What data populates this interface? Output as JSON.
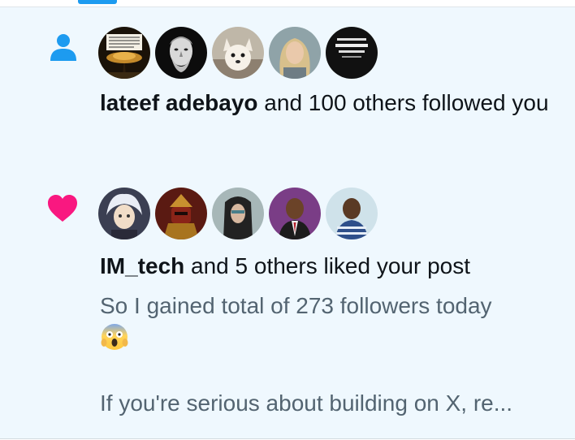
{
  "notifications": [
    {
      "type": "follow",
      "icon": "person-icon",
      "avatars": [
        "avatar-dark-tree-quote",
        "avatar-statue-bust",
        "avatar-white-dog",
        "avatar-blonde-woman",
        "avatar-black-tshirt"
      ],
      "actor": "lateef adebayo",
      "text": " and 100 others followed you"
    },
    {
      "type": "like",
      "icon": "heart-icon",
      "avatars": [
        "avatar-anime-white-hair",
        "avatar-red-armor",
        "avatar-dark-hair-warrior",
        "avatar-man-suit",
        "avatar-man-striped-shirt"
      ],
      "actor": "IM_tech",
      "text": " and 5 others liked your post",
      "post_snippet": {
        "line1": "So I gained total of 273 followers today",
        "emoji": "face-screaming-in-fear-emoji",
        "line3": "If you're serious about building on X, re..."
      }
    }
  ],
  "colors": {
    "accent": "#1d9bf0",
    "like": "#f91880",
    "unread_bg": "#eff8fe",
    "secondary_text": "#536471"
  }
}
